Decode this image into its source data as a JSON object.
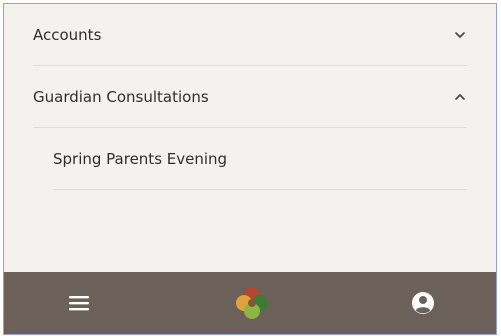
{
  "menu": {
    "items": [
      {
        "label": "Accounts",
        "expanded": false,
        "chevron": "chevron-down-icon"
      },
      {
        "label": "Guardian Consultations",
        "expanded": true,
        "chevron": "chevron-up-icon"
      }
    ],
    "subitems": [
      {
        "label": "Spring Parents Evening"
      }
    ]
  },
  "bottom_bar": {
    "menu_icon": "hamburger-menu-icon",
    "logo_icon": "app-logo-icon",
    "profile_icon": "user-profile-icon",
    "background": "#6b605a"
  },
  "colors": {
    "panel_bg": "#f3f2ee",
    "text": "#2f2f2f",
    "divider": "#e1dfd9"
  }
}
